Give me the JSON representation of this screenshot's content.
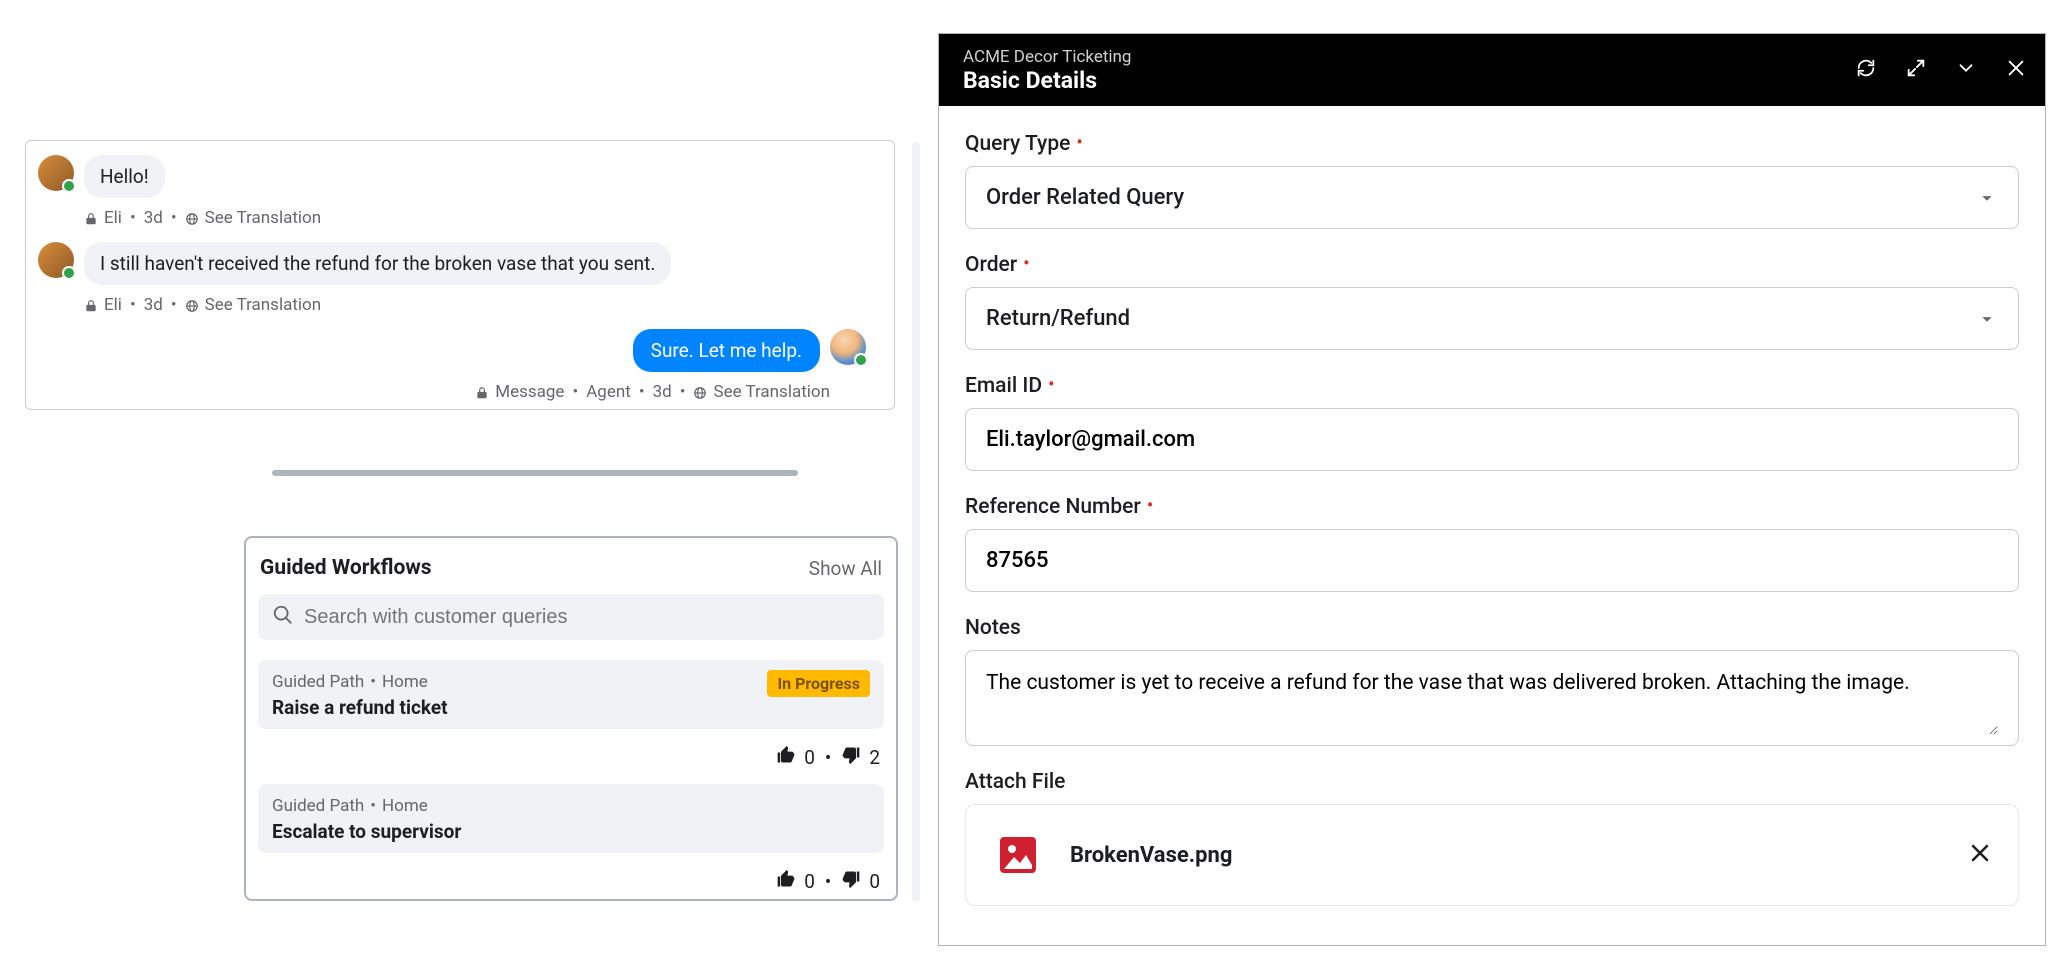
{
  "chat": {
    "messages": [
      {
        "from": "customer",
        "name": "Eli",
        "time": "3d",
        "text": "Hello!",
        "see_translation": "See Translation"
      },
      {
        "from": "customer",
        "name": "Eli",
        "time": "3d",
        "text": "I still haven't received the refund for the broken vase that you sent.",
        "see_translation": "See Translation"
      },
      {
        "from": "agent",
        "name": "Agent",
        "time": "3d",
        "text": "Sure. Let me help.",
        "see_translation": "See Translation",
        "badge": "Message"
      }
    ]
  },
  "guided": {
    "title": "Guided Workflows",
    "show_all": "Show All",
    "search_placeholder": "Search with customer queries",
    "items": [
      {
        "crumb1": "Guided Path",
        "crumb2": "Home",
        "title": "Raise a refund ticket",
        "status": "In Progress",
        "up": "0",
        "down": "2"
      },
      {
        "crumb1": "Guided Path",
        "crumb2": "Home",
        "title": "Escalate to supervisor",
        "status": "",
        "up": "0",
        "down": "0"
      }
    ]
  },
  "ticket": {
    "app": "ACME Decor Ticketing",
    "section": "Basic Details",
    "fields": {
      "query_type_label": "Query Type",
      "query_type_value": "Order Related Query",
      "order_label": "Order",
      "order_value": "Return/Refund",
      "email_label": "Email ID",
      "email_value": "Eli.taylor@gmail.com",
      "ref_label": "Reference Number",
      "ref_value": "87565",
      "notes_label": "Notes",
      "notes_value": "The customer is yet to receive a refund for the vase that was delivered broken. Attaching the image.",
      "attach_label": "Attach File",
      "attach_filename": "BrokenVase.png"
    }
  }
}
